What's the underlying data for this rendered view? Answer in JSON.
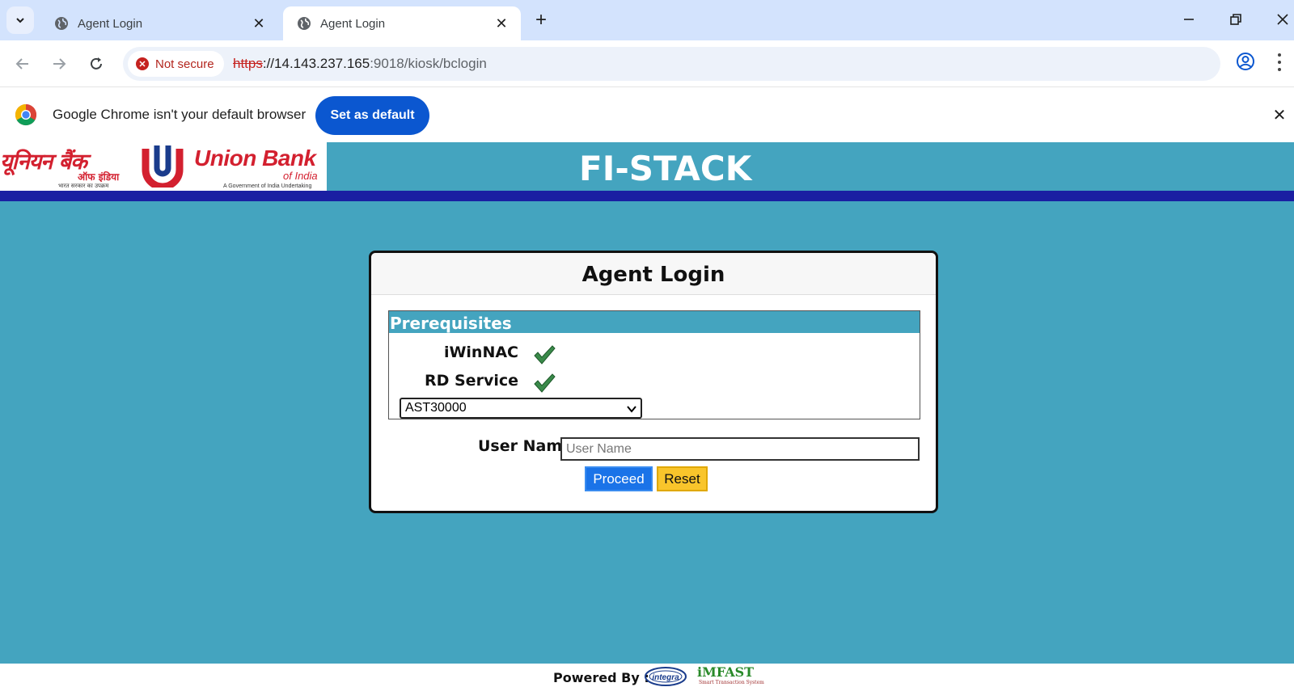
{
  "browser": {
    "tabs": [
      {
        "title": "Agent Login",
        "active": false
      },
      {
        "title": "Agent Login",
        "active": true
      }
    ],
    "omnibox": {
      "security_label": "Not secure",
      "url_scheme": "https",
      "url_rest": "://14.143.237.165",
      "url_path": ":9018/kiosk/bclogin"
    },
    "infobar": {
      "message": "Google Chrome isn't your default browser",
      "button_label": "Set as default"
    }
  },
  "header": {
    "brand_title": "FI-STACK",
    "logo": {
      "hindi_name": "यूनियन बैंक",
      "hindi_sub": "ऑफ इंडिया",
      "hindi_tagline": "भारत सरकार का उपक्रम",
      "english_name": "Union Bank",
      "english_sub": "of India",
      "english_tagline": "A Government of India Undertaking"
    }
  },
  "login": {
    "title": "Agent Login",
    "prerequisites": {
      "heading": "Prerequisites",
      "items": [
        {
          "label": "iWinNAC",
          "status": "ok"
        },
        {
          "label": "RD Service",
          "status": "ok"
        }
      ],
      "device_selected": "AST30000"
    },
    "username": {
      "label": "User Name",
      "placeholder": "User Name",
      "value": ""
    },
    "proceed_label": "Proceed",
    "reset_label": "Reset"
  },
  "footer": {
    "powered_label": "Powered By :",
    "integra_label": "integra",
    "imfast_label": "iMFAST",
    "imfast_sub": "Smart Transaction System"
  },
  "colors": {
    "page_bg": "#44a4bf",
    "navy_bar": "#1a1fa2",
    "proceed": "#1a73e8",
    "reset": "#f9c52b",
    "check": "#3a8a4a",
    "logo_red": "#d3202f"
  }
}
